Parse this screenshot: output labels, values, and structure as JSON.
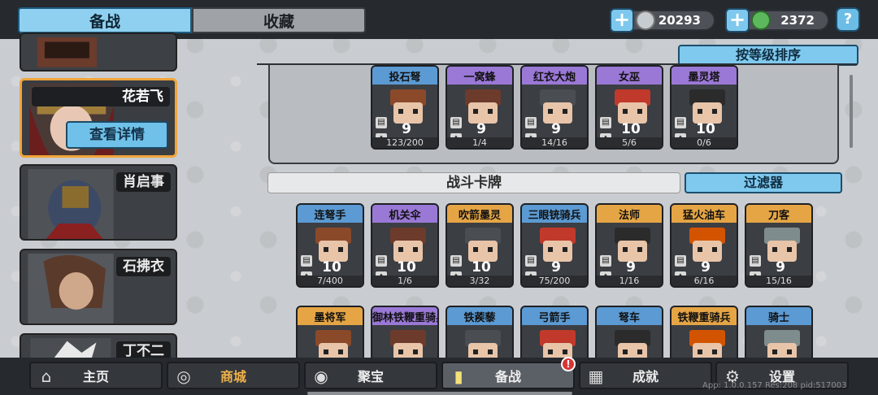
{
  "top_tabs": {
    "prepare": "备战",
    "collection": "收藏"
  },
  "currencies": [
    {
      "name": "silver-coin",
      "value": "20293",
      "color": "#c7ccd1"
    },
    {
      "name": "jade-gem",
      "value": "2372",
      "color": "#5cb85c"
    }
  ],
  "help_label": "?",
  "heroes": [
    {
      "name": ""
    },
    {
      "name": "花若飞",
      "detail_button": "查看详情"
    },
    {
      "name": "肖启事"
    },
    {
      "name": "石拂衣"
    },
    {
      "name": "丁不二"
    }
  ],
  "sort_button": "按等级排序",
  "deck_cards": [
    {
      "name": "投石弩",
      "level": "9",
      "count": "123/200",
      "rarity": "blue"
    },
    {
      "name": "一窝蜂",
      "level": "9",
      "count": "1/4",
      "rarity": "purple"
    },
    {
      "name": "红衣大炮",
      "level": "9",
      "count": "14/16",
      "rarity": "purple"
    },
    {
      "name": "女巫",
      "level": "10",
      "count": "5/6",
      "rarity": "purple"
    },
    {
      "name": "墨灵塔",
      "level": "10",
      "count": "0/6",
      "rarity": "purple"
    }
  ],
  "battle_cards_title": "战斗卡牌",
  "filter_button": "过滤器",
  "battle_cards": [
    {
      "name": "连弩手",
      "level": "10",
      "count": "7/400",
      "rarity": "blue"
    },
    {
      "name": "机关伞",
      "level": "10",
      "count": "1/6",
      "rarity": "purple"
    },
    {
      "name": "吹箭墨灵",
      "level": "10",
      "count": "3/32",
      "rarity": "orange"
    },
    {
      "name": "三眼铳骑兵",
      "level": "9",
      "count": "75/200",
      "rarity": "blue"
    },
    {
      "name": "法师",
      "level": "9",
      "count": "1/16",
      "rarity": "orange"
    },
    {
      "name": "猛火油车",
      "level": "9",
      "count": "6/16",
      "rarity": "orange"
    },
    {
      "name": "刀客",
      "level": "9",
      "count": "15/16",
      "rarity": "orange"
    },
    {
      "name": "墨将军",
      "rarity": "orange"
    },
    {
      "name": "御林铁鞭重骑兵",
      "rarity": "purple"
    },
    {
      "name": "铁蒺藜",
      "rarity": "blue"
    },
    {
      "name": "弓箭手",
      "rarity": "blue"
    },
    {
      "name": "弩车",
      "rarity": "blue"
    },
    {
      "name": "铁鞭重骑兵",
      "rarity": "orange"
    },
    {
      "name": "骑士",
      "rarity": "blue"
    }
  ],
  "bottom_nav": [
    {
      "label": "主页",
      "icon": "home-icon"
    },
    {
      "label": "商城",
      "icon": "coins-icon"
    },
    {
      "label": "聚宝",
      "icon": "treasure-icon"
    },
    {
      "label": "备战",
      "icon": "cards-icon"
    },
    {
      "label": "成就",
      "icon": "achievement-icon"
    },
    {
      "label": "设置",
      "icon": "gear-icon"
    }
  ],
  "notification_badge": "!",
  "debug_text": "App: 1.0.0.157 Res:208 pid:517003"
}
